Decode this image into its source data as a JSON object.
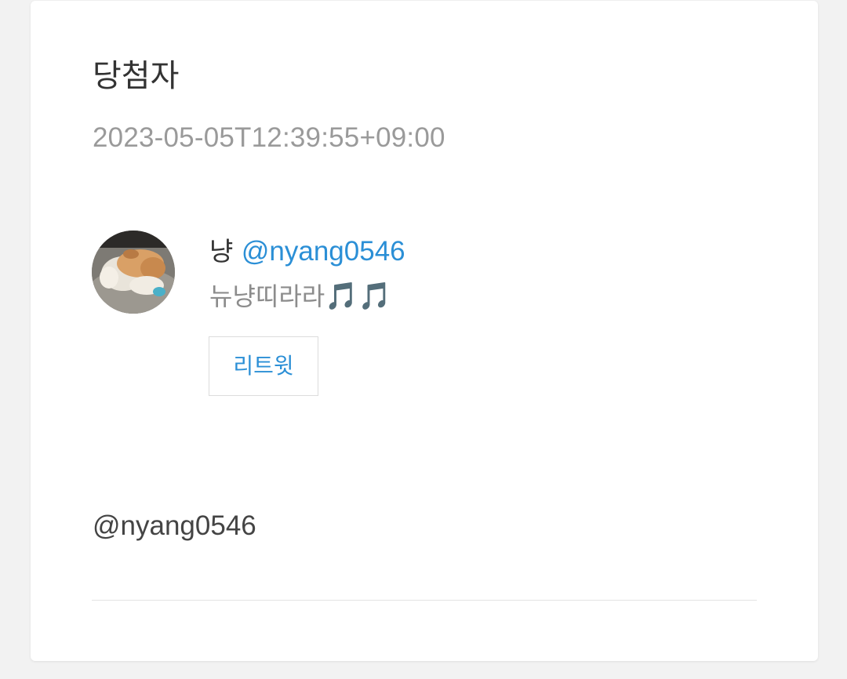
{
  "page": {
    "title": "당첨자",
    "timestamp": "2023-05-05T12:39:55+09:00"
  },
  "tweet": {
    "author_name": "냥",
    "author_handle": "@nyang0546",
    "bio_text": "뉴냥띠라라",
    "bio_emoji": "🎵🎵",
    "retweet_label": "리트윗"
  },
  "winner": {
    "handle": "@nyang0546"
  },
  "colors": {
    "link": "#2b8fd6",
    "muted": "#9a9a9a",
    "card_bg": "#ffffff",
    "page_bg": "#f2f2f2"
  }
}
